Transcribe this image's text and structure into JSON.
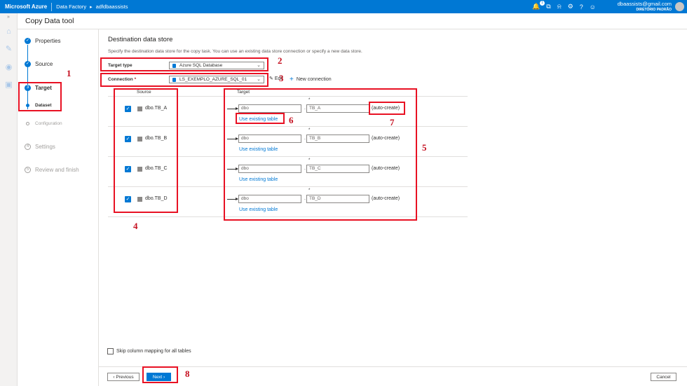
{
  "topbar": {
    "brand": "Microsoft Azure",
    "crumb_service": "Data Factory",
    "crumb_factory": "adfdbaassists",
    "notification_count": "1",
    "user_email": "dbaassists@gmail.com",
    "user_directory": "DIRETÓRIO PADRÃO"
  },
  "header": {
    "title": "Copy Data tool"
  },
  "wizard": {
    "steps": [
      {
        "label": "Properties"
      },
      {
        "label": "Source"
      },
      {
        "label": "Target",
        "number": "3"
      },
      {
        "label": "Dataset"
      },
      {
        "label": "Configuration"
      },
      {
        "label": "Settings",
        "number": "4"
      },
      {
        "label": "Review and finish",
        "number": "5"
      }
    ]
  },
  "main": {
    "title": "Destination data store",
    "description": "Specify the destination data store for the copy task. You can use an existing data store connection or specify a new data store.",
    "target_type_label": "Target type",
    "target_type_value": "Azure SQL Database",
    "connection_label": "Connection",
    "connection_required": "*",
    "connection_value": "LS_EXEMPLO_AZURE_SQL_01",
    "edit_label": "Edit",
    "new_connection_label": "New connection",
    "col_source": "Source",
    "col_target": "Target",
    "rows": [
      {
        "source": "dbo.TB_A",
        "schema": "dbo",
        "table": "TB_A",
        "status": "(auto-create)",
        "use_existing": "Use existing table"
      },
      {
        "source": "dbo.TB_B",
        "schema": "dbo",
        "table": "TB_B",
        "status": "(auto-create)",
        "use_existing": "Use existing table"
      },
      {
        "source": "dbo.TB_C",
        "schema": "dbo",
        "table": "TB_C",
        "status": "(auto-create)",
        "use_existing": "Use existing table"
      },
      {
        "source": "dbo.TB_D",
        "schema": "dbo",
        "table": "TB_D",
        "status": "(auto-create)",
        "use_existing": "Use existing table"
      }
    ],
    "skip_mapping_label": "Skip column mapping for all tables"
  },
  "footer": {
    "previous": "‹ Previous",
    "next": "Next ›",
    "cancel": "Cancel"
  },
  "annotations": [
    "1",
    "2",
    "3",
    "4",
    "5",
    "6",
    "7",
    "8"
  ],
  "colors": {
    "accent": "#0078d4",
    "annotation": "#e81123"
  }
}
